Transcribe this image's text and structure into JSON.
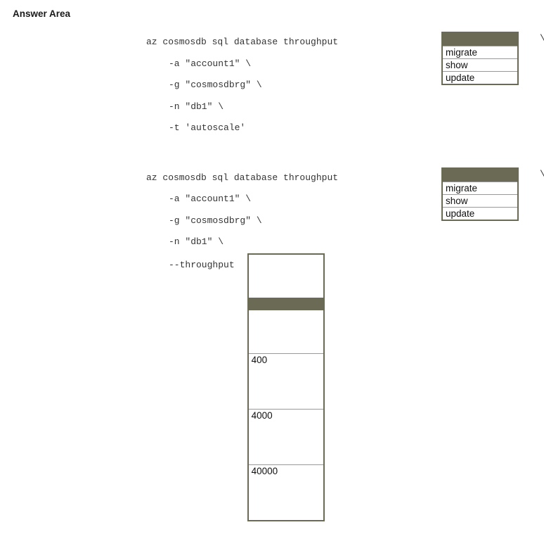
{
  "title": "Answer Area",
  "block1": {
    "firstline": "az cosmosdb sql database throughput",
    "opt_a": "-a \"account1\" \\",
    "opt_g": "-g \"cosmosdbrg\" \\",
    "opt_n": "-n \"db1\" \\",
    "opt_t": "-t 'autoscale'",
    "continuation": "\\",
    "dropdown": {
      "options": [
        "migrate",
        "show",
        "update"
      ]
    }
  },
  "block2": {
    "firstline": "az cosmosdb sql database throughput",
    "opt_a": "-a \"account1\" \\",
    "opt_g": "-g \"cosmosdbrg\" \\",
    "opt_n": "-n \"db1\" \\",
    "opt_thr": "--throughput",
    "continuation": "\\",
    "dropdown1": {
      "options": [
        "migrate",
        "show",
        "update"
      ]
    },
    "dropdown2": {
      "options": [
        "400",
        "4000",
        "40000"
      ]
    }
  }
}
